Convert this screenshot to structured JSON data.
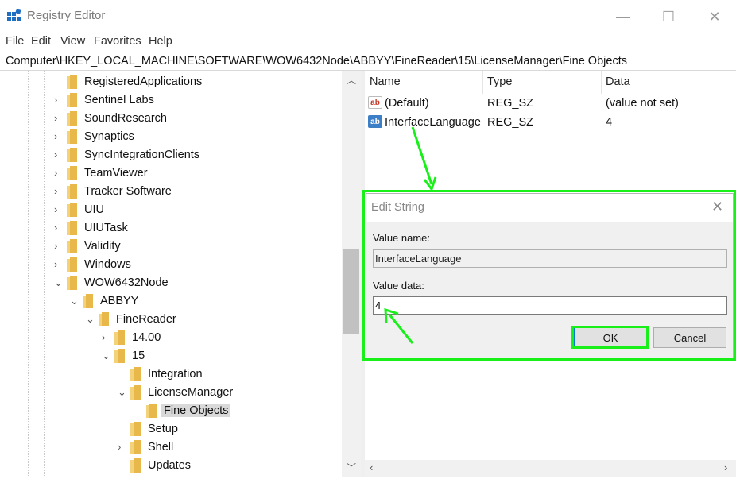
{
  "window": {
    "title": "Registry Editor",
    "minimize": "—",
    "maximize": "☐",
    "close": "✕"
  },
  "menu": [
    "File",
    "Edit",
    "View",
    "Favorites",
    "Help"
  ],
  "address": "Computer\\HKEY_LOCAL_MACHINE\\SOFTWARE\\WOW6432Node\\ABBYY\\FineReader\\15\\LicenseManager\\Fine Objects",
  "tree": [
    {
      "label": "RegisteredApplications",
      "chevron": ""
    },
    {
      "label": "Sentinel Labs",
      "chevron": "›"
    },
    {
      "label": "SoundResearch",
      "chevron": "›"
    },
    {
      "label": "Synaptics",
      "chevron": "›"
    },
    {
      "label": "SyncIntegrationClients",
      "chevron": "›"
    },
    {
      "label": "TeamViewer",
      "chevron": "›"
    },
    {
      "label": "Tracker Software",
      "chevron": "›"
    },
    {
      "label": "UIU",
      "chevron": "›"
    },
    {
      "label": "UIUTask",
      "chevron": "›"
    },
    {
      "label": "Validity",
      "chevron": "›"
    },
    {
      "label": "Windows",
      "chevron": "›"
    },
    {
      "label": "WOW6432Node",
      "chevron": "⌄"
    },
    {
      "label": "ABBYY",
      "chevron": "⌄"
    },
    {
      "label": "FineReader",
      "chevron": "⌄"
    },
    {
      "label": "14.00",
      "chevron": "›"
    },
    {
      "label": "15",
      "chevron": "⌄"
    },
    {
      "label": "Integration",
      "chevron": ""
    },
    {
      "label": "LicenseManager",
      "chevron": "⌄"
    },
    {
      "label": "Fine Objects",
      "chevron": ""
    },
    {
      "label": "Setup",
      "chevron": ""
    },
    {
      "label": "Shell",
      "chevron": "›"
    },
    {
      "label": "Updates",
      "chevron": ""
    }
  ],
  "list": {
    "headers": {
      "name": "Name",
      "type": "Type",
      "data": "Data"
    },
    "rows": [
      {
        "name": "(Default)",
        "type": "REG_SZ",
        "data": "(value not set)",
        "icon": "string-value-icon"
      },
      {
        "name": "InterfaceLanguage",
        "type": "REG_SZ",
        "data": "4",
        "icon": "string-value-icon"
      }
    ],
    "icon_text": "ab"
  },
  "dialog": {
    "title": "Edit String",
    "value_name_label": "Value name:",
    "value_name": "InterfaceLanguage",
    "value_data_label": "Value data:",
    "value_data": "4",
    "ok": "OK",
    "cancel": "Cancel"
  },
  "colors": {
    "highlight": "#19f019",
    "folder": "#e8b84a",
    "selection": "#d9d9d9"
  }
}
